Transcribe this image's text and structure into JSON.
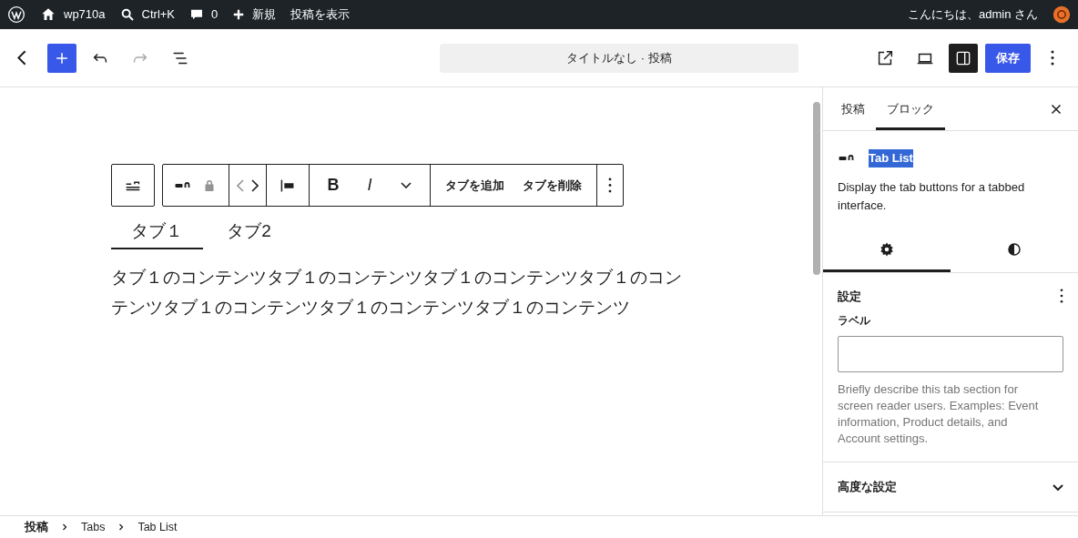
{
  "admin_bar": {
    "site": "wp710a",
    "search": "Ctrl+K",
    "comments": "0",
    "new": "新規",
    "view_post": "投稿を表示",
    "greeting": "こんにちは、admin さん"
  },
  "header": {
    "document_title": "タイトルなし · 投稿",
    "save": "保存",
    "settings_open": true,
    "redo_disabled": true
  },
  "editor": {
    "toolbar": {
      "add_tab": "タブを追加",
      "remove_tab": "タブを削除",
      "bold": "B",
      "italic": "I"
    },
    "tabs": [
      {
        "label": "タブ１",
        "selected": true
      },
      {
        "label": "タブ2",
        "selected": false
      }
    ],
    "content": "タブ１のコンテンツタブ１のコンテンツタブ１のコンテンツタブ１のコンテンツタブ１のコンテンツタブ１のコンテンツタブ１のコンテンツ"
  },
  "sidebar": {
    "tabs": [
      {
        "label": "投稿",
        "selected": false
      },
      {
        "label": "ブロック",
        "selected": true
      }
    ],
    "block_name": "Tab List",
    "block_description": "Display the tab buttons for a tabbed interface.",
    "inspector_tabs": [
      {
        "kind": "settings",
        "selected": true
      },
      {
        "kind": "styles",
        "selected": false
      }
    ],
    "settings_title": "設定",
    "label_field": {
      "label": "ラベル"
    },
    "help": "Briefly describe this tab section for screen reader users. Examples: Event information, Product details, and Account settings.",
    "advanced": {
      "title": "高度な設定",
      "expanded": false
    }
  },
  "breadcrumb": [
    "投稿",
    "Tabs",
    "Tab List"
  ]
}
